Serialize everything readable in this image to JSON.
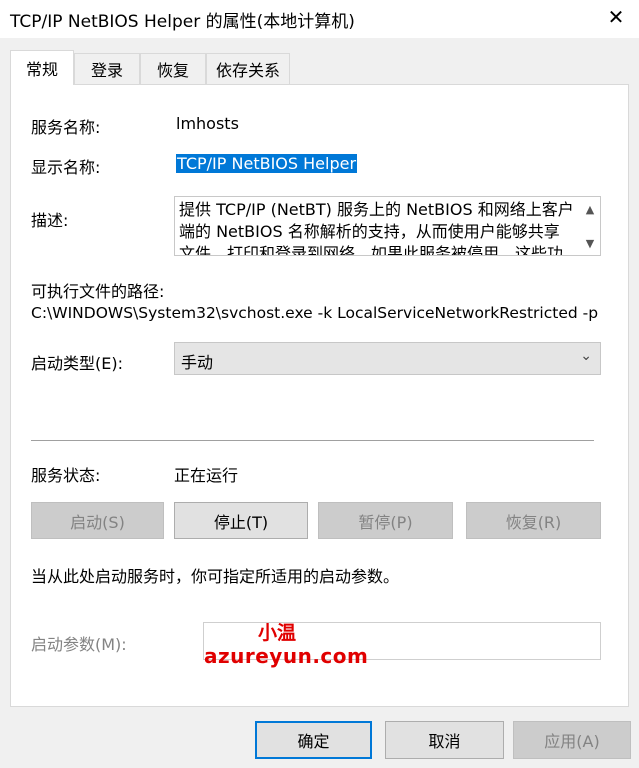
{
  "window": {
    "title": "TCP/IP NetBIOS Helper 的属性(本地计算机)",
    "close_symbol": "✕"
  },
  "tabs": [
    {
      "label": "常规",
      "active": true
    },
    {
      "label": "登录",
      "active": false
    },
    {
      "label": "恢复",
      "active": false
    },
    {
      "label": "依存关系",
      "active": false
    }
  ],
  "general": {
    "service_name_label": "服务名称:",
    "service_name": "lmhosts",
    "display_name_label": "显示名称:",
    "display_name": "TCP/IP NetBIOS Helper",
    "description_label": "描述:",
    "description": "提供 TCP/IP (NetBT) 服务上的 NetBIOS 和网络上客户端的 NetBIOS 名称解析的支持，从而使用户能够共享文件、打印和登录到网络。如果此服务被停用，这些功",
    "exe_path_label": "可执行文件的路径:",
    "exe_path": "C:\\WINDOWS\\System32\\svchost.exe -k LocalServiceNetworkRestricted -p",
    "startup_type_label": "启动类型(E):",
    "startup_type": "手动",
    "service_status_label": "服务状态:",
    "service_status": "正在运行",
    "hint": "当从此处启动服务时，你可指定所适用的启动参数。",
    "start_params_label": "启动参数(M):",
    "start_params_value": ""
  },
  "control_buttons": {
    "start": "启动(S)",
    "stop": "停止(T)",
    "pause": "暂停(P)",
    "resume": "恢复(R)"
  },
  "dialog_buttons": {
    "ok": "确定",
    "cancel": "取消",
    "apply": "应用(A)"
  },
  "watermark": {
    "line1": "小温",
    "line2": "azureyun.com"
  },
  "colors": {
    "selection": "#0078d7",
    "watermark": "#e00000"
  }
}
